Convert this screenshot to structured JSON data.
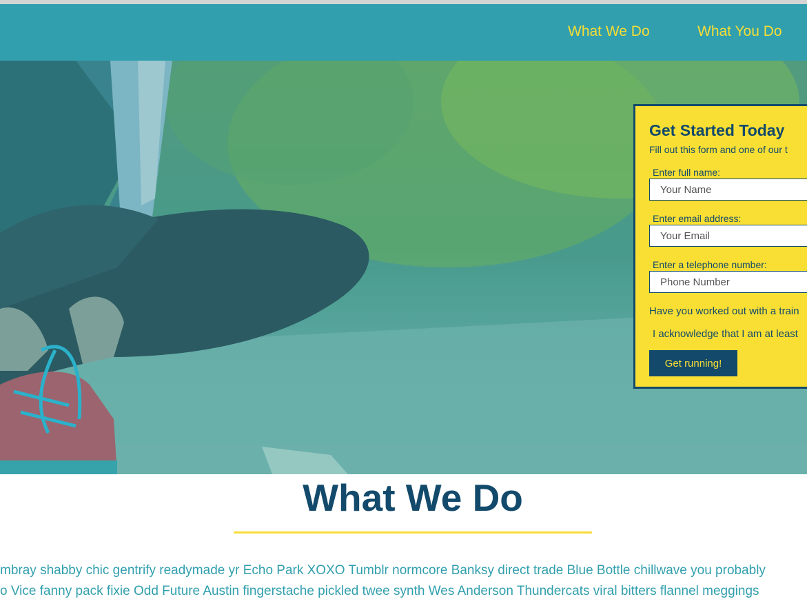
{
  "nav": {
    "links": [
      "What We Do",
      "What You Do"
    ]
  },
  "form": {
    "title": "Get Started Today",
    "subtitle": "Fill out this form and one of our t",
    "name_label": "Enter full name:",
    "name_placeholder": "Your Name",
    "email_label": "Enter email address:",
    "email_placeholder": "Your Email",
    "phone_label": "Enter a telephone number:",
    "phone_placeholder": "Phone Number",
    "trainer_question": "Have you worked out with a train",
    "acknowledge": "I acknowledge that I am at least",
    "submit_label": "Get running!"
  },
  "section": {
    "title": "What We Do",
    "text_lines": [
      "mbray shabby chic gentrify readymade yr Echo Park XOXO Tumblr normcore Banksy direct trade Blue Bottle chillwave you probably",
      "o Vice fanny pack fixie Odd Future Austin fingerstache pickled twee synth Wes Anderson Thundercats viral bitters flannel meggings"
    ]
  },
  "colors": {
    "nav_bg": "#319fad",
    "accent_yellow": "#f9df33",
    "navy": "#134a6b",
    "teal_text": "#319fad"
  }
}
